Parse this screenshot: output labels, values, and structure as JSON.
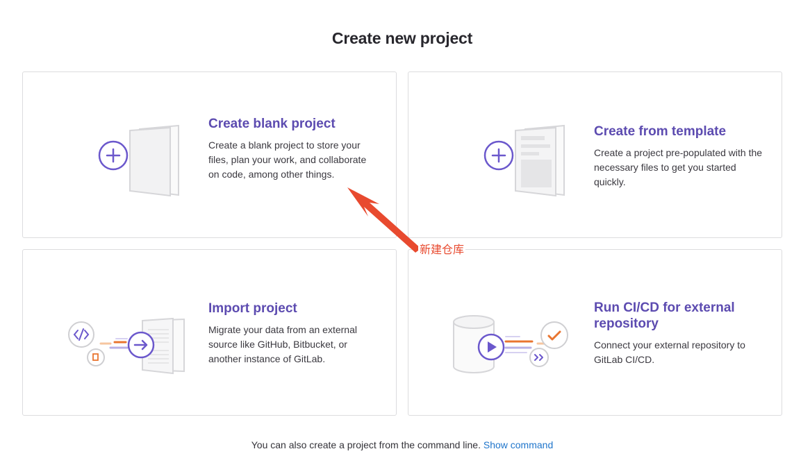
{
  "page": {
    "title": "Create new project"
  },
  "cards": {
    "blank": {
      "title": "Create blank project",
      "description": "Create a blank project to store your files, plan your work, and collaborate on code, among other things."
    },
    "template": {
      "title": "Create from template",
      "description": "Create a project pre-populated with the necessary files to get you started quickly."
    },
    "import": {
      "title": "Import project",
      "description": "Migrate your data from an external source like GitHub, Bitbucket, or another instance of GitLab."
    },
    "cicd": {
      "title": "Run CI/CD for external repository",
      "description": "Connect your external repository to GitLab CI/CD."
    }
  },
  "footer": {
    "text": "You can also create a project from the command line.",
    "link": "Show command"
  },
  "annotation": {
    "label": "新建仓库"
  },
  "colors": {
    "accent_purple": "#5c4bb0",
    "link_blue": "#1f75cb",
    "annotation_red": "#e84a2f",
    "icon_orange": "#e97530"
  }
}
